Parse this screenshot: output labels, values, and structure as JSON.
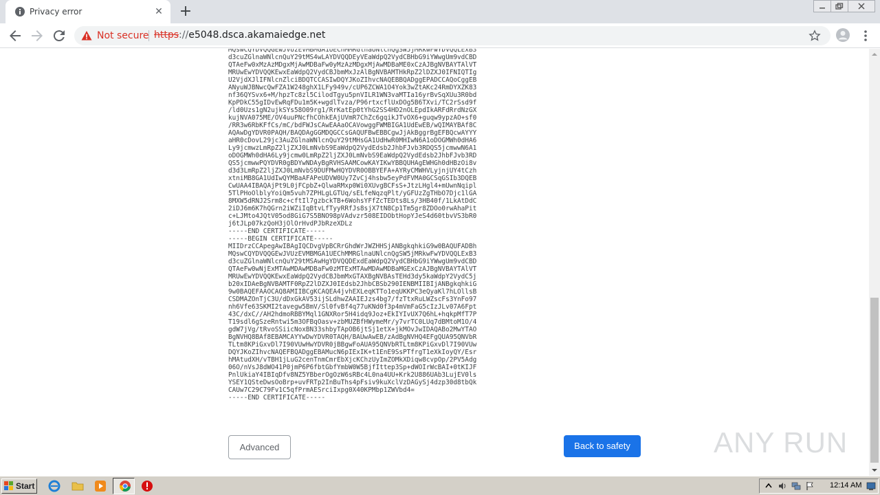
{
  "tab": {
    "title": "Privacy error"
  },
  "toolbar": {
    "not_secure": "Not secure",
    "url_scheme": "https",
    "url_rest": "://",
    "url_host": "e5048.dsca.akamaiedge.net"
  },
  "content": {
    "certificate_text": "MQswCQYDVQQGEwJVUzEVMBMGA1UEChMMRGlnaUNlcnQgSW5jMRkwFwYDVQQLExB3\nd3cuZGlnaWNlcnQuY29tMS4wLAYDVQQDEyVEaWdpQ2VydCBHbG9iYWwgUm9vdCBD\nQTAeFw0xMzAzMDgxMjAwMDBaFw0yMzAzMDgxMjAwMDBaME0xCzAJBgNVBAYTAlVT\nMRUwEwYDVQQKEwxEaWdpQ2VydCBJbmMxJzAlBgNVBAMTHkRpZ2lDZXJ0IFNIQTIg\nU2VjdXJlIFNlcnZlciBDQTCCASIwDQYJKoZIhvcNAQEBBQADggEPADCCAQoCggEB\nANyuWJBNwcQwFZA1W248ghX1LFy949v/cUP6ZCWA1O4Yok3wZtAKc24RmDYXZK83\nnf36QYSvx6+M/hpzTc8zl5CilodTgyu5pnVILR1WN3vaMTIa16yrBvSqXUu3R0bd\nKpPDkC55gIDvEwRqFDu1m5K+wgdlTvza/P96rtxcflUxDOg5B6TXvi/TC2rSsd9f\n/ld0Uzs1gN2ujkSYs58O09rg1/RrKatEp0tYhG2SS4HD2nOLEpdIkARFdRrdNzGX\nkujNVA075ME/OV4uuPNcfhCOhkEAjUVmR7ChZc6gqikJTvOX6+guqw9ypzAO+sf0\n/RR3w6RbKFfCs/mC/bdFWJsCAwEAAaOCAVowggFWMBIGA1UdEwEB/wQIMAYBAf8C\nAQAwDgYDVR0PAQH/BAQDAgGGMDQGCCsGAQUFBwEBBCgwJjAkBggrBgEFBQcwAYYY\naHR0cDovL29jc3AuZGlnaWNlcnQuY29tMHsGA1UdHwR0MHIwN6A1oDOGMWh0dHA6\nLy9jcmwzLmRpZ2ljZXJ0LmNvbS9EaWdpQ2VydEdsb2JhbFJvb3RDQS5jcmwwN6A1\noDOGMWh0dHA6Ly9jcmw0LmRpZ2ljZXJ0LmNvbS9EaWdpQ2VydEdsb2JhbFJvb3RD\nQS5jcmwwPQYDVR0gBDYwNDAyBgRVHSAAMCowKAYIKwYBBQUHAgEWHGh0dHBzOi8v\nd3d3LmRpZ2ljZXJ0LmNvbS9DUFMwHQYDVR0OBBYEFA+AYRyCMWHVLyjnjUY4tCzh\nxtniMB8GA1UdIwQYMBaAFAPeUDVW0Uy7ZvCj4hsbw5eyPdFVMA0GCSqGSIb3DQEB\nCwUAA4IBAQAjPt9L0jFCpbZ+QlwaRMxp0Wi0XUvgBCFsS+JtzLHgl4+mUwnNqipl\n5TlPHoOlblyYoiQm5vuh7ZPHLgLGTUq/sELfeNqzqPlt/yGFUzZgTHbO7Djc1lGA\n8MXW5dRNJ2Srm8c+cftIl7gzbckTB+6WohsYFfZcTEDts8Ls/3HB40f/1LkAtDdC\n2iDJ6m6K7hQGrn2iWZiIqBtvLfTyyRRfJs8sjX7tN8Cp1Tm5gr8ZDOo0rwAhaPit\nc+LJMto4JQtV05od8GiG7S5BNO98pVAdvzr508EIDObtHopYJeS4d60tbvVS3bR0\nj6tJLp07kzQoH3jOlOrHvdPJbRzeXDLz\n-----END CERTIFICATE-----\n-----BEGIN CERTIFICATE-----\nMIIDrzCCApegAwIBAgIQCDvgVpBCRrGhdWrJWZHHSjANBgkqhkiG9w0BAQUFADBh\nMQswCQYDVQQGEwJVUzEVMBMGA1UEChMMRGlnaUNlcnQgSW5jMRkwFwYDVQQLExB3\nd3cuZGlnaWNlcnQuY29tMSAwHgYDVQQDExdEaWdpQ2VydCBHbG9iYWwgUm9vdCBD\nQTAeFw0wNjExMTAwMDAwMDBaFw0zMTExMTAwMDAwMDBaMGExCzAJBgNVBAYTAlVT\nMRUwEwYDVQQKEwxEaWdpQ2VydCBJbmMxGTAXBgNVBAsTEHd3dy5kaWdpY2VydC5j\nb20xIDAeBgNVBAMTF0RpZ2lDZXJ0IEdsb2JhbCBSb290IENBMIIBIjANBgkqhkiG\n9w0BAQEFAAOCAQ8AMIIBCgKCAQEA4jvhEXLeqKTTo1eqUKKPC3eQyaKl7hLOllsB\nCSDMAZOnTjC3U/dDxGkAV53ijSLdhwZAAIEJzs4bg7/fzTtxRuLWZscFs3YnFo97\nnh6Vfe63SKMI2tavegw5BmV/Sl0fvBf4q77uKNd0f3p4mVmFaG5cIzJLv07A6Fpt\n43C/dxC//AH2hdmoRBBYMql1GNXRor5H4idq9Joz+EkIYIvUX7Q6hL+hqkpMfT7P\nT19sdl6gSzeRntwi5m3OFBqOasv+zbMUZBfHWymeMr/y7vrTC0LUq7dBMtoM1O/4\ngdW7jVg/tRvoSSiicNoxBN33shbyTApOB6jtSj1etX+jkMOvJwIDAQABo2MwYTAO\nBgNVHQ8BAf8EBAMCAYYwDwYDVR0TAQH/BAUwAwEB/zAdBgNVHQ4EFgQUA95QNVbR\nTLtm8KPiGxvDl7I90VUwHwYDVR0jBBgwFoAUA95QNVbRTLtm8KPiGxvDl7I90VUw\nDQYJKoZIhvcNAQEFBQADggEBAMucN6pIExIK+t1EnE9SsPTfrgT1eXkIoyQY/Esr\nhMAtudXH/vTBH1jLuG2cenTnmCmrEbXjcKChzUyImZOMkXDiqw8cvpOp/2PV5Adg\n06O/nVsJ8dWO41P0jmP6P6fbtGbfYmbW0W5BjfIttep3Sp+dWOIrWcBAI+0tKIJF\nPnlUkiaY4IBIqDfv8NZ5YBberOgOzW6sRBc4L0na4UU+Krk2U886UAb3LujEV0ls\nYSEY1QSteDwsOoBrp+uvFRTp2InBuThs4pFsiv9kuXclVzDAGySj4dzp30d8tbQk\nCAUw7C29C79Fv1C5qfPrmAESrciIxpg0X40KPMbp1ZWVbd4=\n-----END CERTIFICATE-----",
    "advanced_label": "Advanced",
    "back_to_safety_label": "Back to safety"
  },
  "watermark": {
    "text": "ANY RUN"
  },
  "taskbar": {
    "start_label": "Start",
    "clock": "12:14 AM"
  },
  "colors": {
    "accent": "#1a73e8",
    "warning": "#d93025",
    "tabstrip": "#dee1e6",
    "taskbar": "#d4d0c8"
  },
  "icons": {
    "favicon": "info-circle-icon",
    "warning": "warning-triangle-icon",
    "star": "bookmark-star-icon",
    "profile": "profile-avatar-icon",
    "menu": "kebab-menu-icon"
  }
}
